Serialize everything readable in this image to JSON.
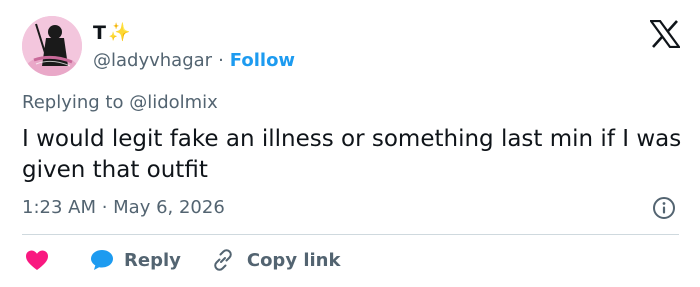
{
  "author": {
    "display_name": "T",
    "sparkle_glyph": "✨",
    "handle": "@ladyvhagar",
    "separator": "·",
    "follow_label": "Follow"
  },
  "reply_context": "Replying to @lidolmix",
  "tweet": {
    "text": "I would legit fake an illness or something last min if I was given that outfit",
    "timestamp": "1:23 AM · May 6, 2026"
  },
  "actions": {
    "reply_label": "Reply",
    "copy_link_label": "Copy link"
  },
  "icons": {
    "logo": "x-logo-icon",
    "info": "info-icon",
    "like": "heart-icon",
    "reply": "speech-bubble-icon",
    "copy": "link-icon"
  },
  "colors": {
    "text": "#0f1419",
    "secondary": "#536471",
    "accent": "#1d9bf0",
    "like": "#f91880",
    "divider": "#cfd9de"
  }
}
